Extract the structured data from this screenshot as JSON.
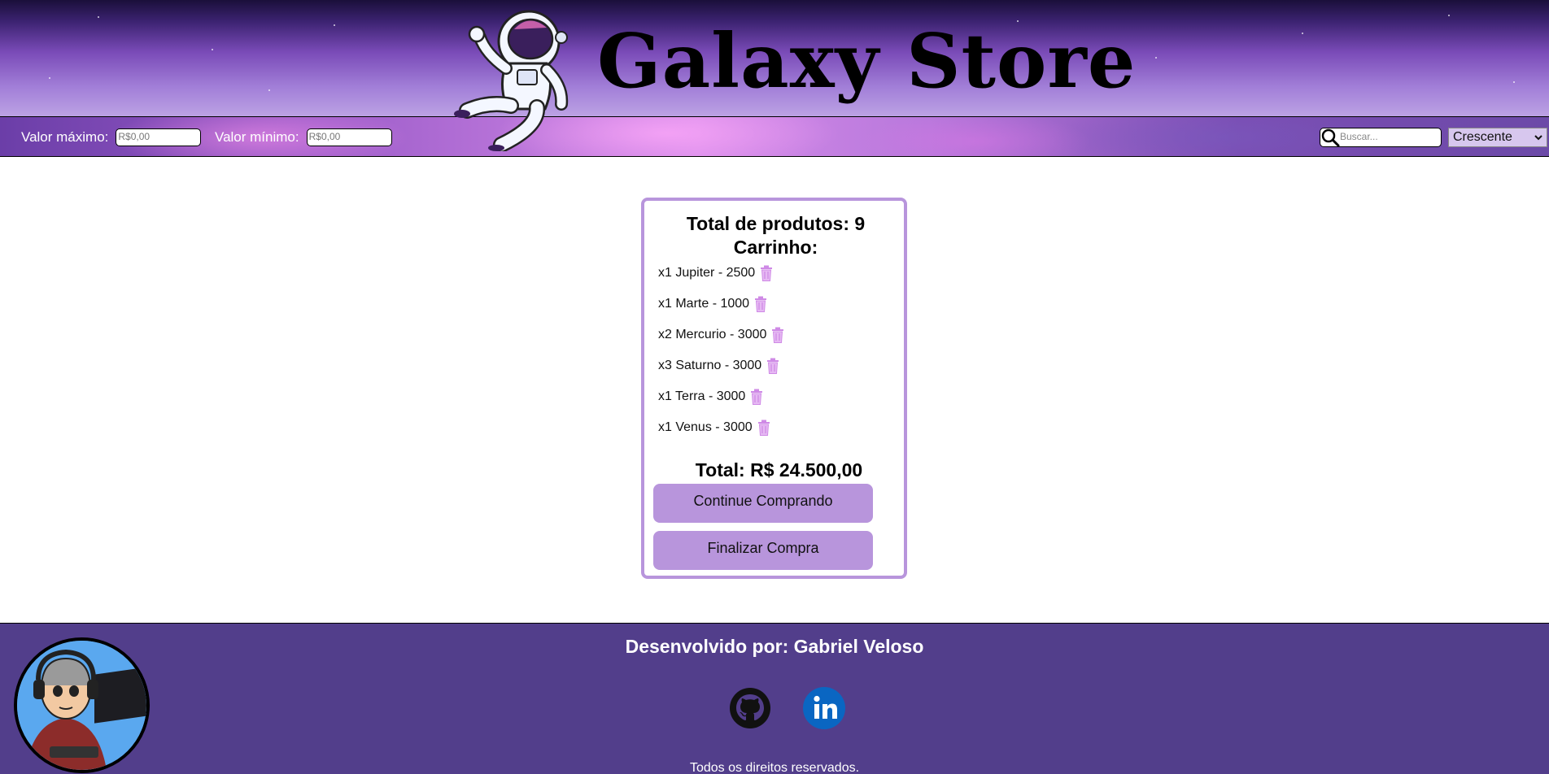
{
  "header": {
    "brand_title": "Galaxy Store",
    "max_value_label": "Valor máximo:",
    "max_value_placeholder": "R$0,00",
    "min_value_label": "Valor mínimo:",
    "min_value_placeholder": "R$0,00",
    "search_placeholder": "Buscar...",
    "sort_selected": "Crescente"
  },
  "cart": {
    "total_products": "Total de produtos: 9",
    "heading": "Carrinho:",
    "items": [
      {
        "text": "x1 Jupiter - 2500"
      },
      {
        "text": "x1 Marte - 1000"
      },
      {
        "text": "x2 Mercurio - 3000"
      },
      {
        "text": "x3 Saturno - 3000"
      },
      {
        "text": "x1 Terra - 3000"
      },
      {
        "text": "x1 Venus - 3000"
      }
    ],
    "total_label": "Total: R$ 24.500,00",
    "continue_button": "Continue Comprando",
    "checkout_button": "Finalizar Compra"
  },
  "footer": {
    "credit": "Desenvolvido por: Gabriel Veloso",
    "rights": "Todos os direitos reservados."
  },
  "colors": {
    "accent": "#b895dc",
    "footer_bg": "#523e8b",
    "trash": "#cf8ae6"
  },
  "icons": [
    "astronaut-logo",
    "search-icon",
    "trash-icon",
    "github-icon",
    "linkedin-icon",
    "avatar"
  ]
}
